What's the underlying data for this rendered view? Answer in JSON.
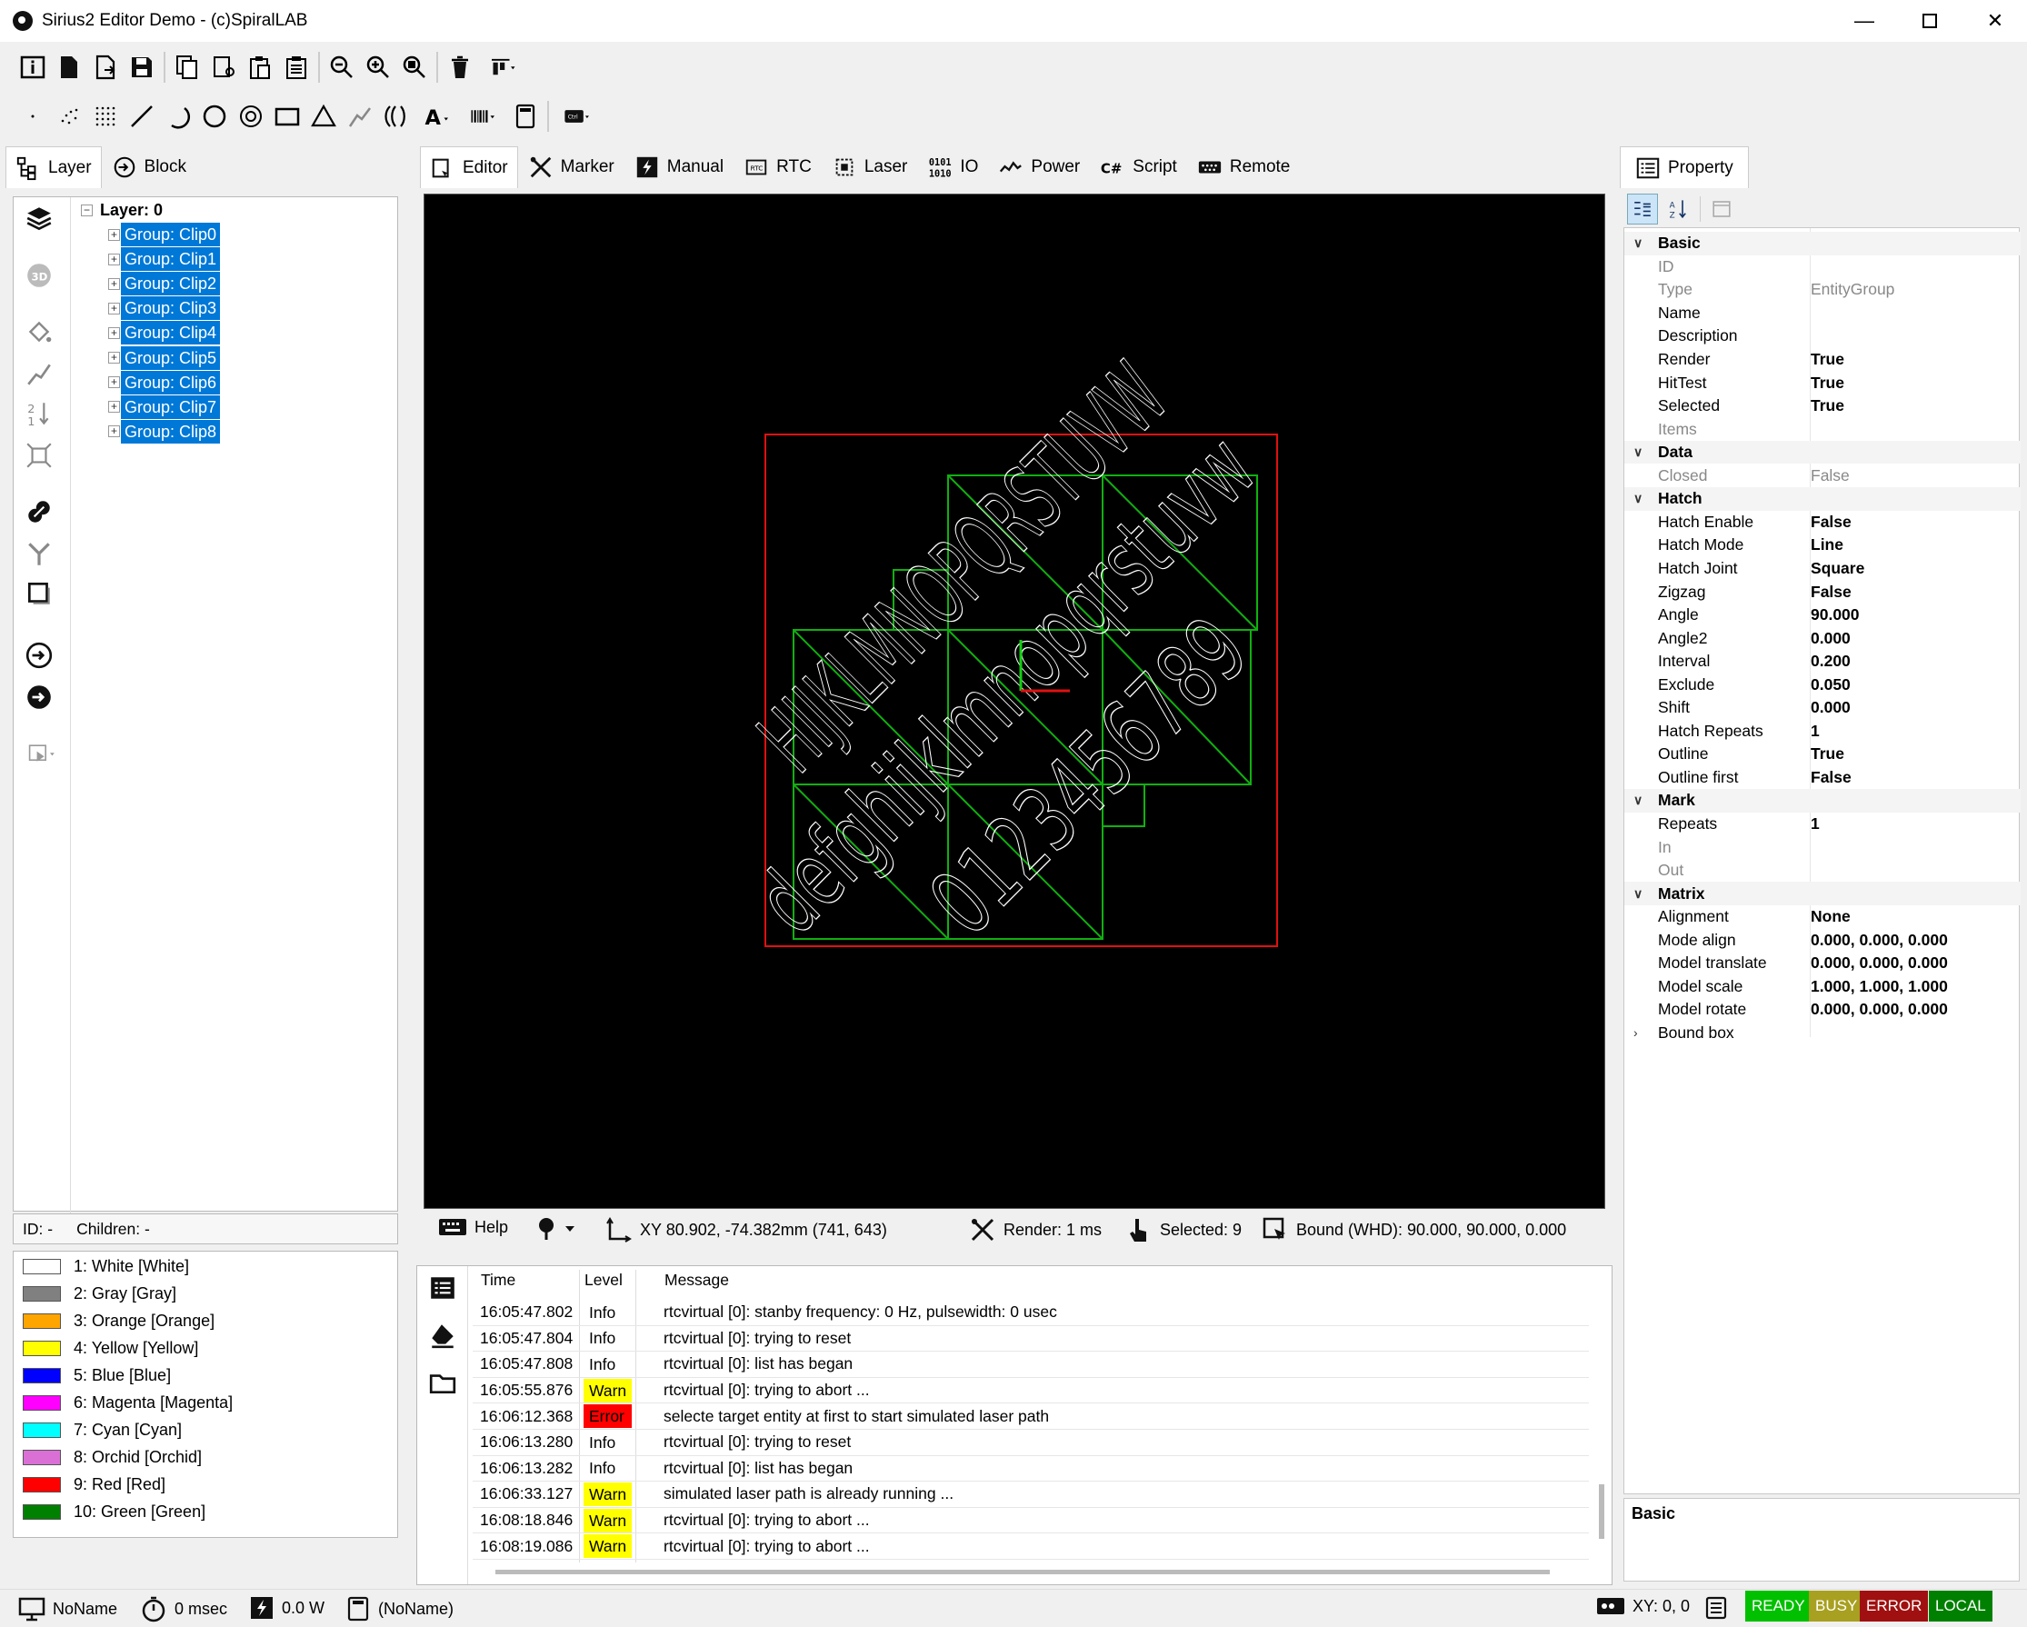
{
  "window": {
    "title": "Sirius2 Editor Demo - (c)SpiralLAB"
  },
  "left_tabs": [
    {
      "label": "Layer"
    },
    {
      "label": "Block"
    }
  ],
  "main_tabs": [
    {
      "label": "Editor",
      "icon": "editor-icon"
    },
    {
      "label": "Marker",
      "icon": "marker-icon"
    },
    {
      "label": "Manual",
      "icon": "manual-icon"
    },
    {
      "label": "RTC",
      "icon": "rtc-icon"
    },
    {
      "label": "Laser",
      "icon": "laser-icon"
    },
    {
      "label": "IO",
      "icon": "io-icon"
    },
    {
      "label": "Power",
      "icon": "power-icon"
    },
    {
      "label": "Script",
      "icon": "script-icon"
    },
    {
      "label": "Remote",
      "icon": "remote-icon"
    }
  ],
  "tree": {
    "root": "Layer: 0",
    "items": [
      "Group: Clip0",
      "Group: Clip1",
      "Group: Clip2",
      "Group: Clip3",
      "Group: Clip4",
      "Group: Clip5",
      "Group: Clip6",
      "Group: Clip7",
      "Group: Clip8"
    ]
  },
  "tree_status": {
    "id": "ID: -",
    "children": "Children: -"
  },
  "pens": [
    {
      "label": "1: White [White]",
      "color": "#ffffff"
    },
    {
      "label": "2: Gray [Gray]",
      "color": "#808080"
    },
    {
      "label": "3: Orange [Orange]",
      "color": "#ffa500"
    },
    {
      "label": "4: Yellow [Yellow]",
      "color": "#ffff00"
    },
    {
      "label": "5: Blue [Blue]",
      "color": "#0000ff"
    },
    {
      "label": "6: Magenta [Magenta]",
      "color": "#ff00ff"
    },
    {
      "label": "7: Cyan [Cyan]",
      "color": "#00ffff"
    },
    {
      "label": "8: Orchid [Orchid]",
      "color": "#da70d6"
    },
    {
      "label": "9: Red [Red]",
      "color": "#ff0000"
    },
    {
      "label": "10: Green [Green]",
      "color": "#008000"
    }
  ],
  "canvas": {
    "text_upper": "HIJKLMNOPQRSTUVW",
    "text_lower": "defghijklmnopqrstuvw",
    "text_digits": "0123456789"
  },
  "editor_status": {
    "help": "Help",
    "xy": "XY 80.902, -74.382mm (741, 643)",
    "render": "Render: 1 ms",
    "selected": "Selected: 9",
    "bound": "Bound (WHD): 90.000, 90.000, 0.000"
  },
  "log": {
    "headers": {
      "time": "Time",
      "level": "Level",
      "message": "Message"
    },
    "rows": [
      {
        "time": "16:05:47.802",
        "level": "Info",
        "message": "rtcvirtual [0]: stanby frequency: 0 Hz, pulsewidth: 0 usec"
      },
      {
        "time": "16:05:47.804",
        "level": "Info",
        "message": "rtcvirtual [0]: trying to reset"
      },
      {
        "time": "16:05:47.808",
        "level": "Info",
        "message": "rtcvirtual [0]: list has began"
      },
      {
        "time": "16:05:55.876",
        "level": "Warn",
        "message": "rtcvirtual [0]: trying to abort ..."
      },
      {
        "time": "16:06:12.368",
        "level": "Error",
        "message": "selecte target entity at first to start simulated laser path"
      },
      {
        "time": "16:06:13.280",
        "level": "Info",
        "message": "rtcvirtual [0]: trying to reset"
      },
      {
        "time": "16:06:13.282",
        "level": "Info",
        "message": "rtcvirtual [0]: list has began"
      },
      {
        "time": "16:06:33.127",
        "level": "Warn",
        "message": "simulated laser path is already running ..."
      },
      {
        "time": "16:08:18.846",
        "level": "Warn",
        "message": "rtcvirtual [0]: trying to abort ..."
      },
      {
        "time": "16:08:19.086",
        "level": "Warn",
        "message": "rtcvirtual [0]: trying to abort ..."
      }
    ],
    "level_colors": {
      "Info": "transparent",
      "Warn": "#ffff00",
      "Error": "#ff0000"
    }
  },
  "property": {
    "tab": "Property",
    "rows": [
      {
        "type": "cat",
        "key": "Basic"
      },
      {
        "key": "ID",
        "value": "",
        "dim": true
      },
      {
        "key": "Type",
        "value": "EntityGroup",
        "dim": true
      },
      {
        "key": "Name",
        "value": ""
      },
      {
        "key": "Description",
        "value": ""
      },
      {
        "key": "Render",
        "value": "True"
      },
      {
        "key": "HitTest",
        "value": "True"
      },
      {
        "key": "Selected",
        "value": "True"
      },
      {
        "key": "Items",
        "value": "",
        "dim": true
      },
      {
        "type": "cat",
        "key": "Data"
      },
      {
        "key": "Closed",
        "value": "False",
        "dim": true
      },
      {
        "type": "cat",
        "key": "Hatch"
      },
      {
        "key": "Hatch Enable",
        "value": "False"
      },
      {
        "key": "Hatch Mode",
        "value": "Line"
      },
      {
        "key": "Hatch Joint",
        "value": "Square"
      },
      {
        "key": "Zigzag",
        "value": "False"
      },
      {
        "key": "Angle",
        "value": "90.000"
      },
      {
        "key": "Angle2",
        "value": "0.000"
      },
      {
        "key": "Interval",
        "value": "0.200"
      },
      {
        "key": "Exclude",
        "value": "0.050"
      },
      {
        "key": "Shift",
        "value": "0.000"
      },
      {
        "key": "Hatch Repeats",
        "value": "1"
      },
      {
        "key": "Outline",
        "value": "True"
      },
      {
        "key": "Outline first",
        "value": "False"
      },
      {
        "type": "cat",
        "key": "Mark"
      },
      {
        "key": "Repeats",
        "value": "1"
      },
      {
        "key": "In",
        "value": "",
        "dim": true
      },
      {
        "key": "Out",
        "value": "",
        "dim": true
      },
      {
        "type": "cat",
        "key": "Matrix"
      },
      {
        "key": "Alignment",
        "value": "None"
      },
      {
        "key": "Mode align",
        "value": "0.000, 0.000, 0.000"
      },
      {
        "key": "Model translate",
        "value": "0.000, 0.000, 0.000"
      },
      {
        "key": "Model scale",
        "value": "1.000, 1.000, 1.000"
      },
      {
        "key": "Model rotate",
        "value": "0.000, 0.000, 0.000"
      },
      {
        "type": "collapsed",
        "key": "Bound box"
      }
    ],
    "description_title": "Basic"
  },
  "statusbar": {
    "name": "NoName",
    "time": "0 msec",
    "power": "0.0 W",
    "doc": "(NoName)",
    "xy": "XY: 0, 0",
    "ready": "READY",
    "busy": "BUSY",
    "error": "ERROR",
    "local": "LOCAL",
    "colors": {
      "ready": "#00c000",
      "busy": "#a8a020",
      "error": "#a01010",
      "local": "#008000"
    }
  }
}
